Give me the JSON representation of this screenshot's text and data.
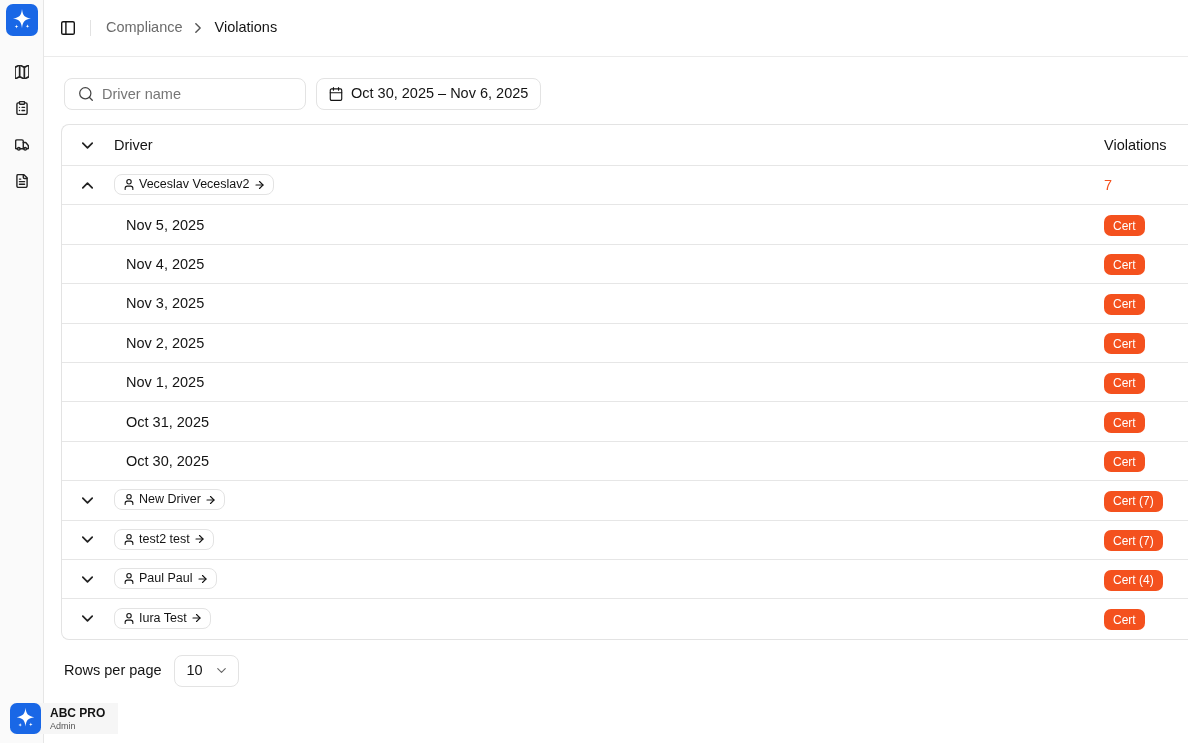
{
  "header": {
    "breadcrumbs": [
      {
        "label": "Compliance",
        "current": false
      },
      {
        "label": "Violations",
        "current": true
      }
    ]
  },
  "filters": {
    "search": {
      "placeholder": "Driver name"
    },
    "date_range": "Oct 30, 2025 – Nov 6, 2025"
  },
  "table": {
    "expanded": false,
    "columns": [
      "Driver",
      "Violations"
    ],
    "rows": [
      {
        "driver": "Veceslav Veceslav2",
        "expanded": true,
        "violations": "7",
        "children": [
          {
            "date": "Nov 5, 2025",
            "violations": "Cert"
          },
          {
            "date": "Nov 4, 2025",
            "violations": "Cert"
          },
          {
            "date": "Nov 3, 2025",
            "violations": "Cert"
          },
          {
            "date": "Nov 2, 2025",
            "violations": "Cert"
          },
          {
            "date": "Nov 1, 2025",
            "violations": "Cert"
          },
          {
            "date": "Oct 31, 2025",
            "violations": "Cert"
          },
          {
            "date": "Oct 30, 2025",
            "violations": "Cert"
          }
        ]
      },
      {
        "driver": "New Driver",
        "expanded": false,
        "violations": "Cert (7)"
      },
      {
        "driver": "test2 test",
        "expanded": false,
        "violations": "Cert (7)"
      },
      {
        "driver": "Paul Paul",
        "expanded": false,
        "violations": "Cert (4)"
      },
      {
        "driver": "Iura Test",
        "expanded": false,
        "violations": "Cert"
      }
    ]
  },
  "pagination": {
    "label": "Rows per page",
    "value": "10"
  },
  "account": {
    "name": "ABC PRO",
    "role": "Admin"
  }
}
